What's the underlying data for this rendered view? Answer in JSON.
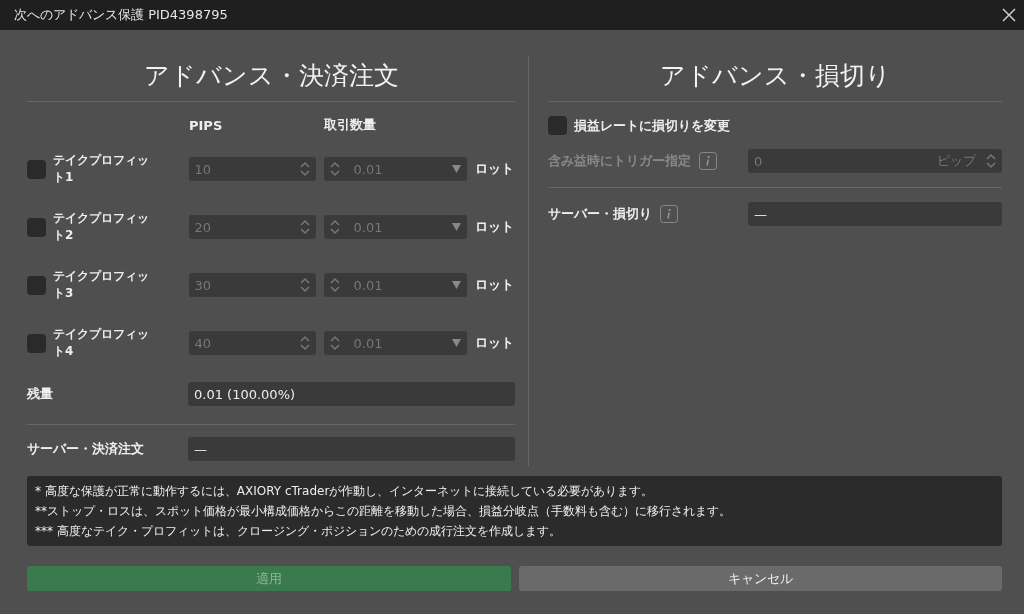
{
  "window": {
    "title": "次へのアドバンス保護 PID4398795"
  },
  "take_profit": {
    "title": "アドバンス・決済注文",
    "columns": [
      "PIPS",
      "取引数量"
    ],
    "rows": [
      {
        "label": "テイクプロフィット1",
        "checked": false,
        "pips": "10",
        "volume": "0.01",
        "unit": "ロット"
      },
      {
        "label": "テイクプロフィット2",
        "checked": false,
        "pips": "20",
        "volume": "0.01",
        "unit": "ロット"
      },
      {
        "label": "テイクプロフィット3",
        "checked": false,
        "pips": "30",
        "volume": "0.01",
        "unit": "ロット"
      },
      {
        "label": "テイクプロフィット4",
        "checked": false,
        "pips": "40",
        "volume": "0.01",
        "unit": "ロット"
      }
    ],
    "remaining": {
      "label": "残量",
      "value": "0.01 (100.00%)"
    },
    "server": {
      "label": "サーバー・決済注文",
      "value": "—"
    }
  },
  "stop_loss": {
    "title": "アドバンス・損切り",
    "breakeven": {
      "label": "損益レートに損切りを変更",
      "checked": false
    },
    "trigger": {
      "label": "含み益時にトリガー指定",
      "value": "0",
      "unit": "ピップ",
      "disabled": true
    },
    "server": {
      "label": "サーバー・損切り",
      "value": "—"
    }
  },
  "notes": [
    "* 高度な保護が正常に動作するには、AXIORY cTraderが作動し、インターネットに接続している必要があります。",
    "**ストップ・ロスは、スポット価格が最小構成価格からこの距離を移動した場合、損益分岐点（手数料も含む）に移行されます。",
    "*** 高度なテイク・プロフィットは、クロージング・ポジションのための成行注文を作成します。"
  ],
  "buttons": [
    {
      "label": "適用",
      "kind": "primary",
      "disabled": true
    },
    {
      "label": "キャンセル",
      "kind": "secondary",
      "disabled": false
    }
  ]
}
